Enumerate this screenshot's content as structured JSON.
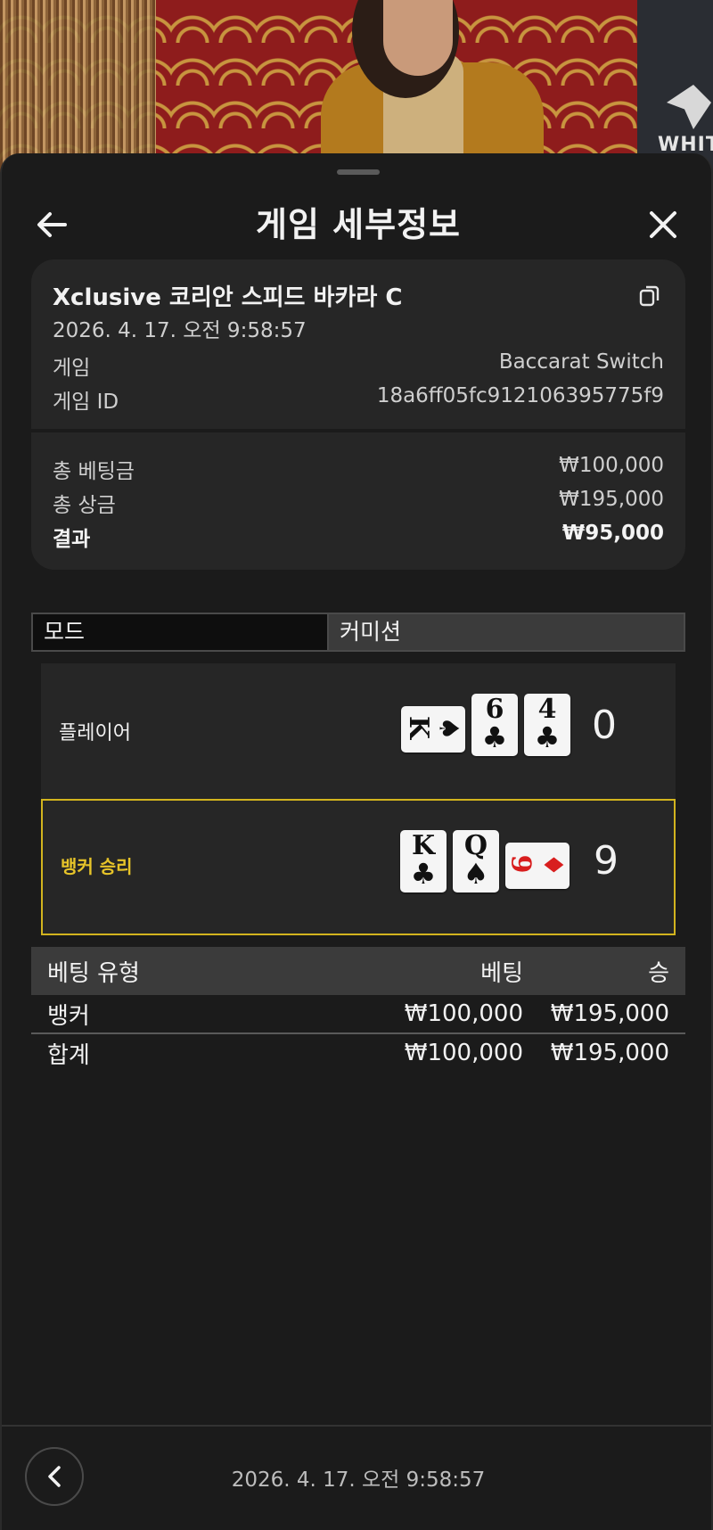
{
  "header": {
    "title": "게임 세부정보"
  },
  "video": {
    "brand_text": "WHIT"
  },
  "info": {
    "table_name": "Xclusive 코리안 스피드 바카라 C",
    "datetime": "2026. 4. 17. 오전 9:58:57",
    "game_label": "게임",
    "game_value": "Baccarat Switch",
    "game_id_label": "게임 ID",
    "game_id_value": "18a6ff05fc912106395775f9",
    "total_bet_label": "총 베팅금",
    "total_bet_value": "₩100,000",
    "total_win_label": "총 상금",
    "total_win_value": "₩195,000",
    "result_label": "결과",
    "result_value": "₩95,000"
  },
  "mode": {
    "label": "모드",
    "value": "커미션"
  },
  "hands": {
    "player": {
      "label": "플레이어",
      "score": "0",
      "cards": [
        {
          "rank": "K",
          "suit": "♠",
          "orientation": "horizontal",
          "color": "black"
        },
        {
          "rank": "6",
          "suit": "♣",
          "orientation": "vertical",
          "color": "black"
        },
        {
          "rank": "4",
          "suit": "♣",
          "orientation": "vertical",
          "color": "black"
        }
      ]
    },
    "banker": {
      "label": "뱅커 승리",
      "score": "9",
      "cards": [
        {
          "rank": "K",
          "suit": "♣",
          "orientation": "vertical",
          "color": "black"
        },
        {
          "rank": "Q",
          "suit": "♠",
          "orientation": "vertical",
          "color": "black"
        },
        {
          "rank": "9",
          "suit": "♦",
          "orientation": "horizontal",
          "color": "red"
        }
      ]
    }
  },
  "bets": {
    "headers": [
      "베팅 유형",
      "베팅",
      "승"
    ],
    "rows": [
      {
        "type": "뱅커",
        "bet": "₩100,000",
        "win": "₩195,000"
      }
    ],
    "total": {
      "type": "합계",
      "bet": "₩100,000",
      "win": "₩195,000"
    }
  },
  "footer": {
    "datetime": "2026. 4. 17. 오전 9:58:57"
  },
  "colors": {
    "background": "#1b1b1b",
    "card_bg": "#262626",
    "winner_border": "#d2b41e",
    "winner_text": "#e7c429"
  }
}
